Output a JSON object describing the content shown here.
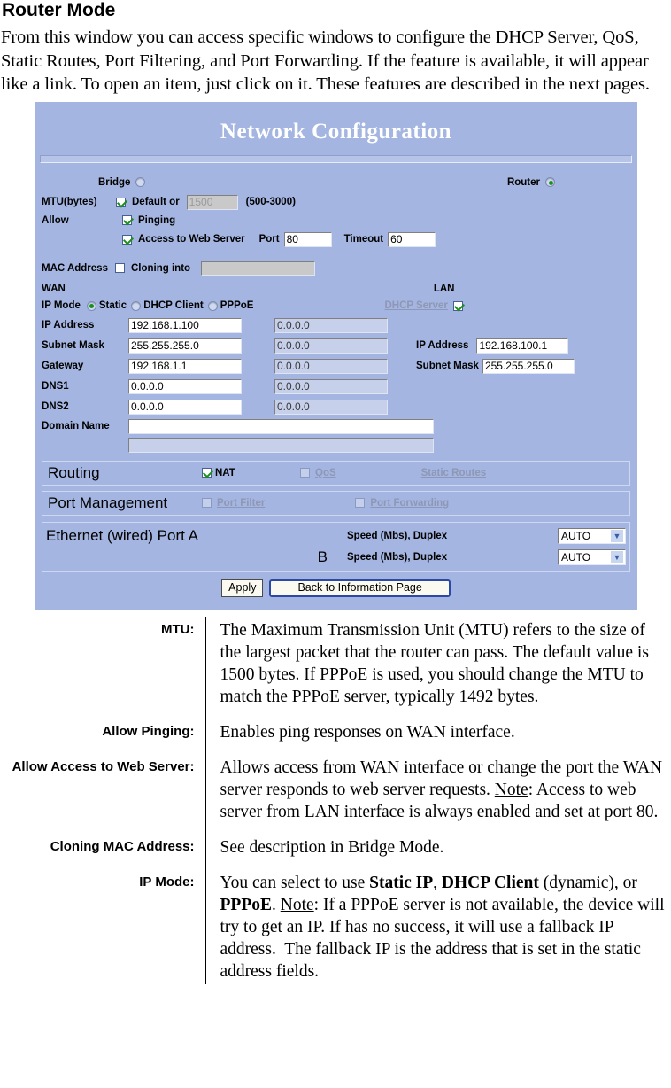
{
  "doc": {
    "title": "Router Mode",
    "intro": "From this window you can access specific windows to configure the DHCP Server, QoS, Static Routes, Port Filtering, and Port Forwarding. If the feature is available, it will appear like a link. To open an item, just click on it. These features are described in the next pages."
  },
  "panel": {
    "title": "Network Configuration",
    "mode": {
      "bridge_label": "Bridge",
      "bridge_selected": false,
      "router_label": "Router",
      "router_selected": true
    },
    "mtu": {
      "label": "MTU(bytes)",
      "default_label": "Default or",
      "default_checked": true,
      "value": "1500",
      "range_label": "(500-3000)"
    },
    "allow": {
      "label": "Allow",
      "pinging_label": "Pinging",
      "pinging_checked": true,
      "web_label": "Access to Web Server",
      "web_checked": true,
      "port_label": "Port",
      "port_value": "80",
      "timeout_label": "Timeout",
      "timeout_value": "60"
    },
    "mac": {
      "label": "MAC Address",
      "clone_label": "Cloning into",
      "clone_checked": false,
      "value": ""
    },
    "wan": {
      "heading": "WAN",
      "ipmode_label": "IP Mode",
      "options": [
        {
          "label": "Static",
          "selected": true
        },
        {
          "label": "DHCP Client",
          "selected": false
        },
        {
          "label": "PPPoE",
          "selected": false
        }
      ],
      "fields": [
        {
          "label": "IP Address",
          "static": "192.168.1.100",
          "dynamic": "0.0.0.0"
        },
        {
          "label": "Subnet Mask",
          "static": "255.255.255.0",
          "dynamic": "0.0.0.0"
        },
        {
          "label": "Gateway",
          "static": "192.168.1.1",
          "dynamic": "0.0.0.0"
        },
        {
          "label": "DNS1",
          "static": "0.0.0.0",
          "dynamic": "0.0.0.0"
        },
        {
          "label": "DNS2",
          "static": "0.0.0.0",
          "dynamic": "0.0.0.0"
        }
      ],
      "domain_label": "Domain Name",
      "domain_value": "",
      "domain_value2": ""
    },
    "lan": {
      "heading": "LAN",
      "dhcp_server_label": "DHCP Server",
      "dhcp_server_checked": true,
      "ip_label": "IP Address",
      "ip_value": "192.168.100.1",
      "mask_label": "Subnet Mask",
      "mask_value": "255.255.255.0"
    },
    "routing": {
      "title": "Routing",
      "nat_label": "NAT",
      "nat_checked": true,
      "qos_label": "QoS",
      "qos_checked": false,
      "static_routes_label": "Static Routes"
    },
    "port_management": {
      "title": "Port Management",
      "port_filter_label": "Port Filter",
      "port_filter_checked": false,
      "port_forwarding_label": "Port Forwarding",
      "port_forwarding_checked": false
    },
    "ethernet": {
      "title": "Ethernet (wired) Port A",
      "port_b": "B",
      "speed_label": "Speed (Mbs), Duplex",
      "port_a_speed": "AUTO",
      "port_b_speed": "AUTO"
    },
    "buttons": {
      "apply": "Apply",
      "back": "Back to Information Page"
    }
  },
  "descriptions": [
    {
      "label": "MTU:",
      "html": "The Maximum Transmission Unit (MTU) refers to the size of the largest packet that the router can pass. The default value is 1500 bytes. If PPPoE is used, you should change the MTU to match the PPPoE server, typically 1492 bytes."
    },
    {
      "label": "Allow Pinging:",
      "html": "Enables ping responses on WAN interface."
    },
    {
      "label": "Allow Access to Web Server:",
      "html": "Allows access from WAN interface or change the port the WAN server responds to web server requests. <u>Note</u>: Access to web server from LAN interface is always enabled and set at port 80."
    },
    {
      "label": "Cloning MAC Address:",
      "html": "See description in Bridge Mode."
    },
    {
      "label": "IP Mode:",
      "html": "You can select to use <b>Static IP</b>, <b>DHCP Client</b> (dynamic), or <b>PPPoE</b>. <u>Note</u>: If a PPPoE server is not available, the device will try to get an IP. If has no success, it will use a fallback IP address.&nbsp; The fallback IP is the address that is set in the static address fields."
    }
  ]
}
